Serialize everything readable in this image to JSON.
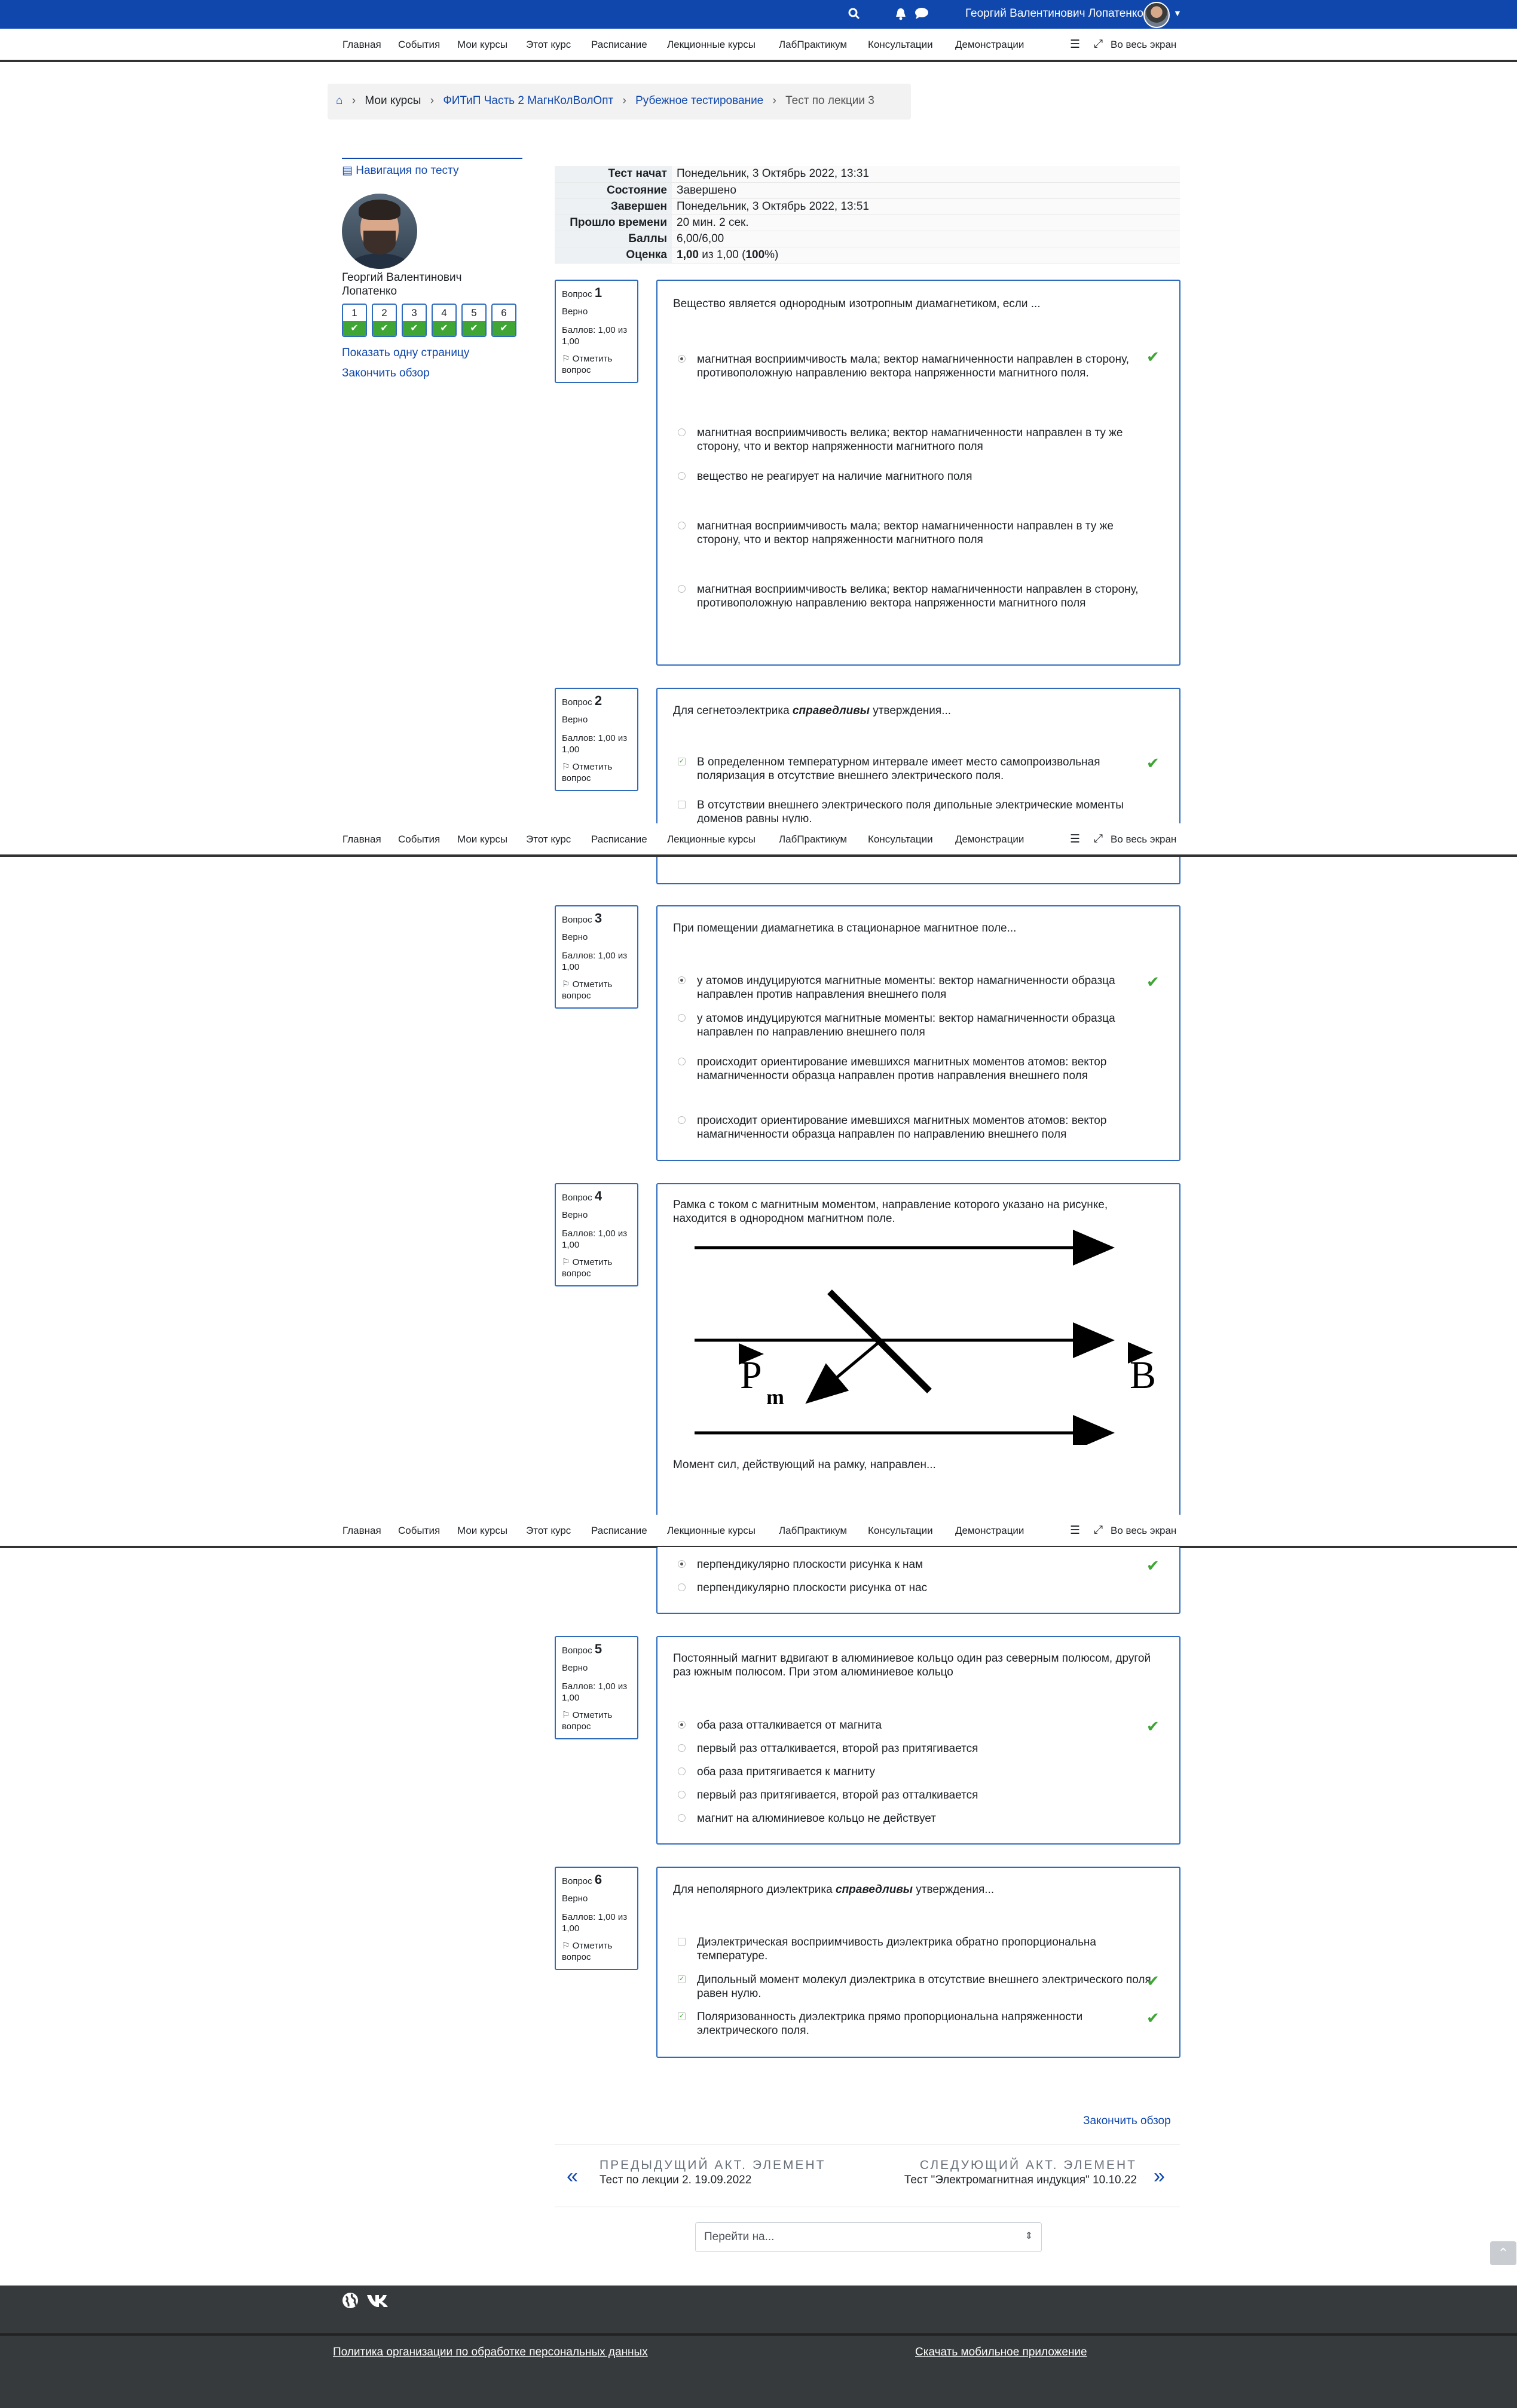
{
  "header": {
    "user_name": "Георгий Валентинович Лопатенко",
    "icons": [
      "search-icon",
      "bell-icon",
      "chat-icon",
      "caret-down-icon"
    ]
  },
  "nav": {
    "items": [
      "Главная",
      "События",
      "Мои курсы",
      "Этот курс",
      "Расписание",
      "Лекционные курсы",
      "ЛабПрактикум",
      "Консультации",
      "Демонстрации"
    ],
    "fullscreen": "Во весь экран"
  },
  "breadcrumb": [
    "Мои курсы",
    "ФИТиП Часть 2 МагнКолВолОпт",
    "Рубежное тестирование",
    "Тест по лекции 3"
  ],
  "quiz_nav": {
    "title": "Навигация по тесту",
    "user_name": "Георгий Валентинович Лопатенко",
    "buttons": [
      "1",
      "2",
      "3",
      "4",
      "5",
      "6"
    ],
    "show_one_page": "Показать одну страницу",
    "finish_review": "Закончить обзор"
  },
  "summary": [
    {
      "k": "Тест начат",
      "v": "Понедельник, 3 Октябрь 2022, 13:31"
    },
    {
      "k": "Состояние",
      "v": "Завершено"
    },
    {
      "k": "Завершен",
      "v": "Понедельник, 3 Октябрь 2022, 13:51"
    },
    {
      "k": "Прошло времени",
      "v": "20 мин. 2 сек."
    },
    {
      "k": "Баллы",
      "v": "6,00/6,00"
    },
    {
      "k": "Оценка",
      "v_bold1": "1,00",
      "v_mid": " из 1,00 (",
      "v_bold2": "100",
      "v_end": "%)"
    }
  ],
  "qinfo": {
    "label": "Вопрос",
    "status": "Верно",
    "grade": "Баллов: 1,00 из 1,00",
    "flag": "Отметить вопрос"
  },
  "questions": [
    {
      "num": "1",
      "text": "Вещество является однородным изотропным диамагнетиком, если ...",
      "answers": [
        "магнитная восприимчивость мала; вектор намагниченности направлен в сторону, противоположную направлению вектора напряженности магнитного поля.",
        "магнитная восприимчивость велика; вектор намагниченности направлен в ту же сторону, что и вектор напряженности магнитного поля",
        "вещество не реагирует на наличие магнитного поля",
        "магнитная восприимчивость мала; вектор намагниченности направлен в ту же сторону, что и вектор напряженности магнитного поля",
        "магнитная восприимчивость велика; вектор намагниченности направлен в сторону, противоположную направлению вектора напряженности магнитного поля"
      ]
    },
    {
      "num": "2",
      "text_pre": "Для сегнетоэлектрика ",
      "text_em": "справедливы",
      "text_post": " утверждения...",
      "answers": [
        "В определенном температурном интервале имеет место самопроизвольная поляризация в отсутствие внешнего электрического поля.",
        "В отсутствии внешнего электрического поля дипольные электрические моменты доменов равны нулю."
      ]
    },
    {
      "num": "3",
      "text": "При помещении диамагнетика в стационарное магнитное поле...",
      "answers": [
        "у атомов индуцируются магнитные моменты: вектор намагниченности образца направлен против направления внешнего поля",
        "у атомов индуцируются магнитные моменты: вектор намагниченности образца направлен по направлению внешнего поля",
        "происходит ориентирование имевшихся магнитных моментов атомов: вектор намагниченности образца направлен против направления внешнего поля",
        "происходит ориентирование имевшихся магнитных моментов атомов: вектор намагниченности образца направлен по направлению внешнего поля"
      ]
    },
    {
      "num": "4",
      "text": "Рамка с током с магнитным моментом, направление которого указано на рисунке, находится в однородном магнитном поле.",
      "figure_labels": {
        "pm": "P",
        "pm_sub": "m",
        "b": "B"
      },
      "text2": "Момент сил, действующий на рамку, направлен...",
      "answers": [
        "перпендикулярно плоскости рисунка к нам",
        "перпендикулярно плоскости рисунка от нас"
      ]
    },
    {
      "num": "5",
      "text": "Постоянный магнит вдвигают в алюминиевое кольцо один раз северным полюсом, другой раз южным полюсом. При этом алюминиевое кольцо",
      "answers": [
        "оба раза отталкивается от магнита",
        "первый раз отталкивается, второй раз притягивается",
        "оба раза притягивается к магниту",
        "первый раз притягивается, второй раз отталкивается",
        "магнит на алюминиевое кольцо не действует"
      ]
    },
    {
      "num": "6",
      "text_pre": "Для неполярного диэлектрика ",
      "text_em": "справедливы",
      "text_post": " утверждения...",
      "answers": [
        "Диэлектрическая восприимчивость диэлектрика обратно пропорциональна температуре.",
        "Дипольный момент молекул диэлектрика в отсутствие внешнего электрического поля равен нулю.",
        "Поляризованность диэлектрика прямо пропорциональна напряженности электрического поля."
      ]
    }
  ],
  "bottom": {
    "finish_review": "Закончить обзор",
    "prev_label": "ПРЕДЫДУЩИЙ АКТ. ЭЛЕМЕНТ",
    "prev_name": "Тест по лекции 2. 19.09.2022",
    "next_label": "СЛЕДУЮЩИЙ АКТ. ЭЛЕМЕНТ",
    "next_name": "Тест \"Электромагнитная индукция\" 10.10.22",
    "jump_placeholder": "Перейти на..."
  },
  "footer": {
    "privacy": "Политика организации по обработке персональных данных",
    "app": "Скачать мобильное приложение"
  },
  "colors": {
    "brand": "#0f47ad",
    "correct": "#3fa535",
    "footer": "#373a3c"
  }
}
